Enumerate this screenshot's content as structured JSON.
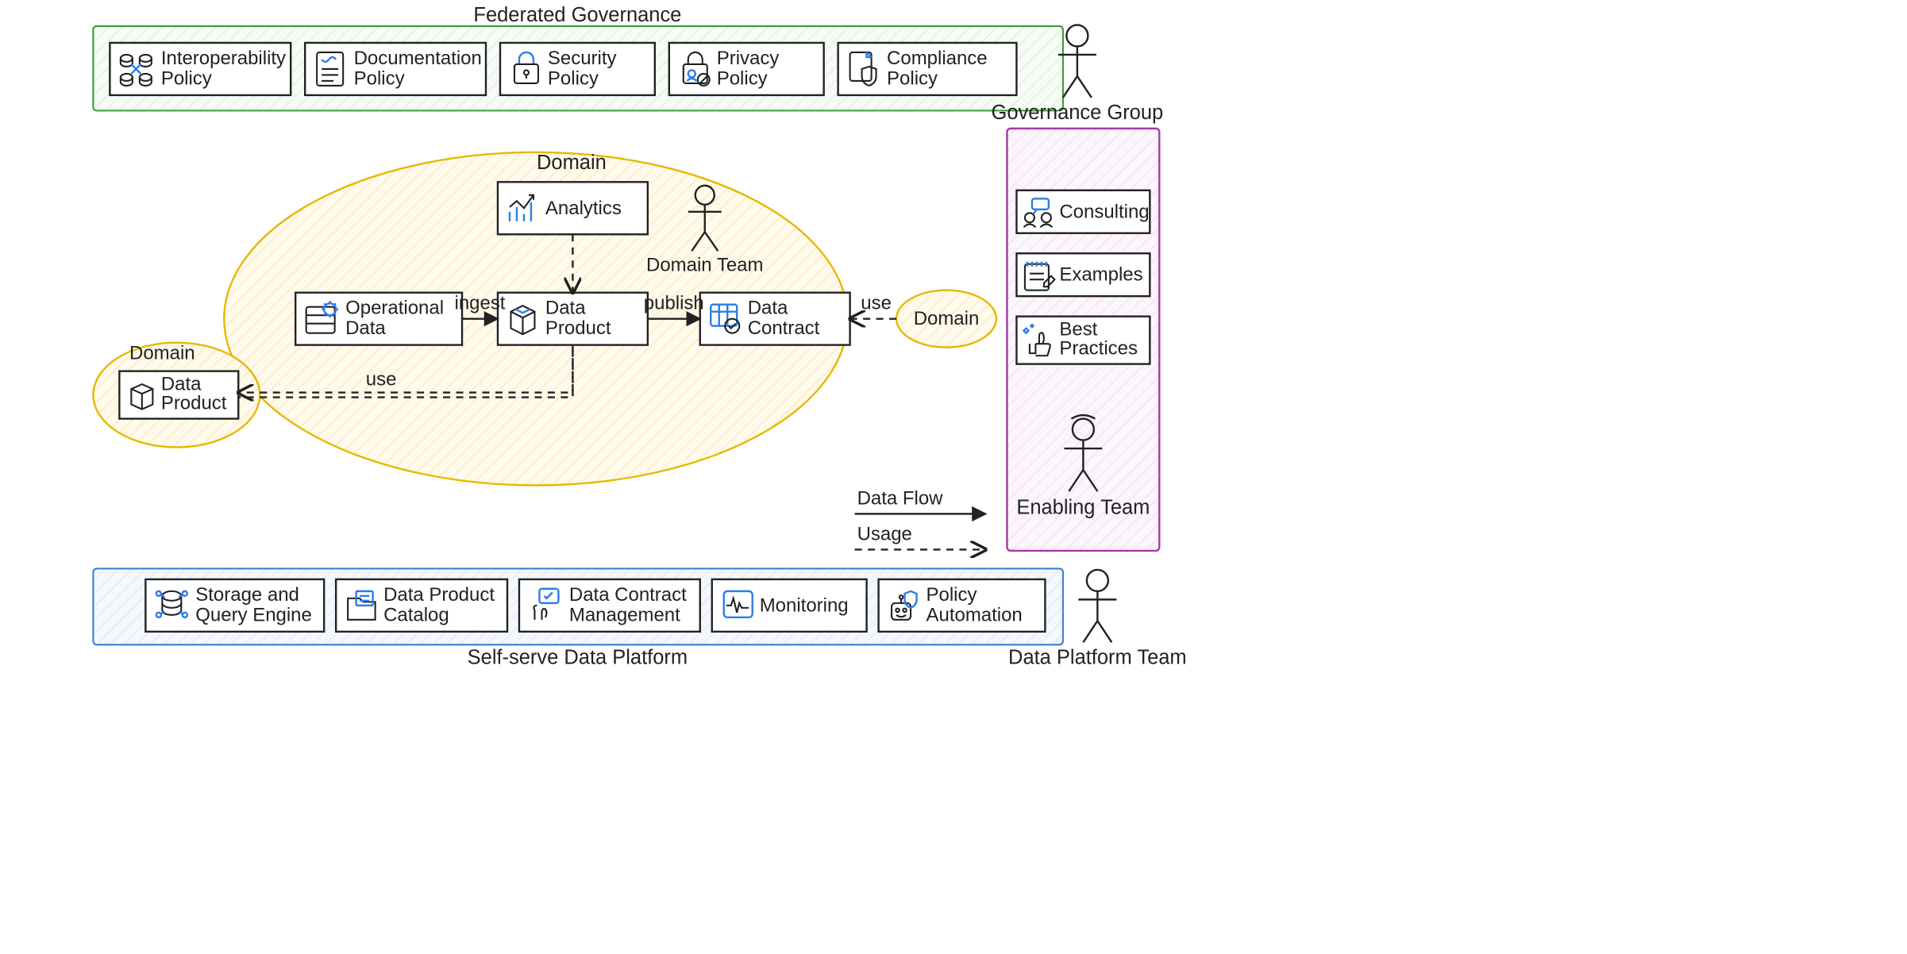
{
  "governance": {
    "title": "Federated Governance",
    "actor": "Governance Group",
    "policies": [
      {
        "name": "interoperability",
        "line1": "Interoperability",
        "line2": "Policy"
      },
      {
        "name": "documentation",
        "line1": "Documentation",
        "line2": "Policy"
      },
      {
        "name": "security",
        "line1": "Security",
        "line2": "Policy"
      },
      {
        "name": "privacy",
        "line1": "Privacy",
        "line2": "Policy"
      },
      {
        "name": "compliance",
        "line1": "Compliance",
        "line2": "Policy"
      }
    ]
  },
  "platform": {
    "title": "Self-serve Data Platform",
    "actor": "Data Platform Team",
    "services": [
      {
        "name": "storage",
        "line1": "Storage and",
        "line2": "Query Engine"
      },
      {
        "name": "catalog",
        "line1": "Data Product",
        "line2": "Catalog"
      },
      {
        "name": "contract-mgmt",
        "line1": "Data Contract",
        "line2": "Management"
      },
      {
        "name": "monitoring",
        "line1": "Monitoring",
        "line2": ""
      },
      {
        "name": "policy-auto",
        "line1": "Policy",
        "line2": "Automation"
      }
    ]
  },
  "enabling": {
    "actor": "Enabling Team",
    "items": [
      {
        "name": "consulting",
        "line1": "Consulting",
        "line2": ""
      },
      {
        "name": "examples",
        "line1": "Examples",
        "line2": ""
      },
      {
        "name": "best-practices",
        "line1": "Best",
        "line2": "Practices"
      }
    ]
  },
  "domain": {
    "label": "Domain",
    "actor": "Domain Team",
    "nodes": {
      "operational": {
        "line1": "Operational",
        "line2": "Data"
      },
      "analytics": {
        "line1": "Analytics",
        "line2": ""
      },
      "product": {
        "line1": "Data",
        "line2": "Product"
      },
      "contract": {
        "line1": "Data",
        "line2": "Contract"
      }
    },
    "other_product": {
      "line1": "Data",
      "line2": "Product",
      "group": "Domain"
    },
    "other_domain": "Domain"
  },
  "edges": {
    "ingest": "ingest",
    "publish": "publish",
    "use1": "use",
    "use2": "use"
  },
  "legend": {
    "flow": "Data Flow",
    "usage": "Usage"
  }
}
